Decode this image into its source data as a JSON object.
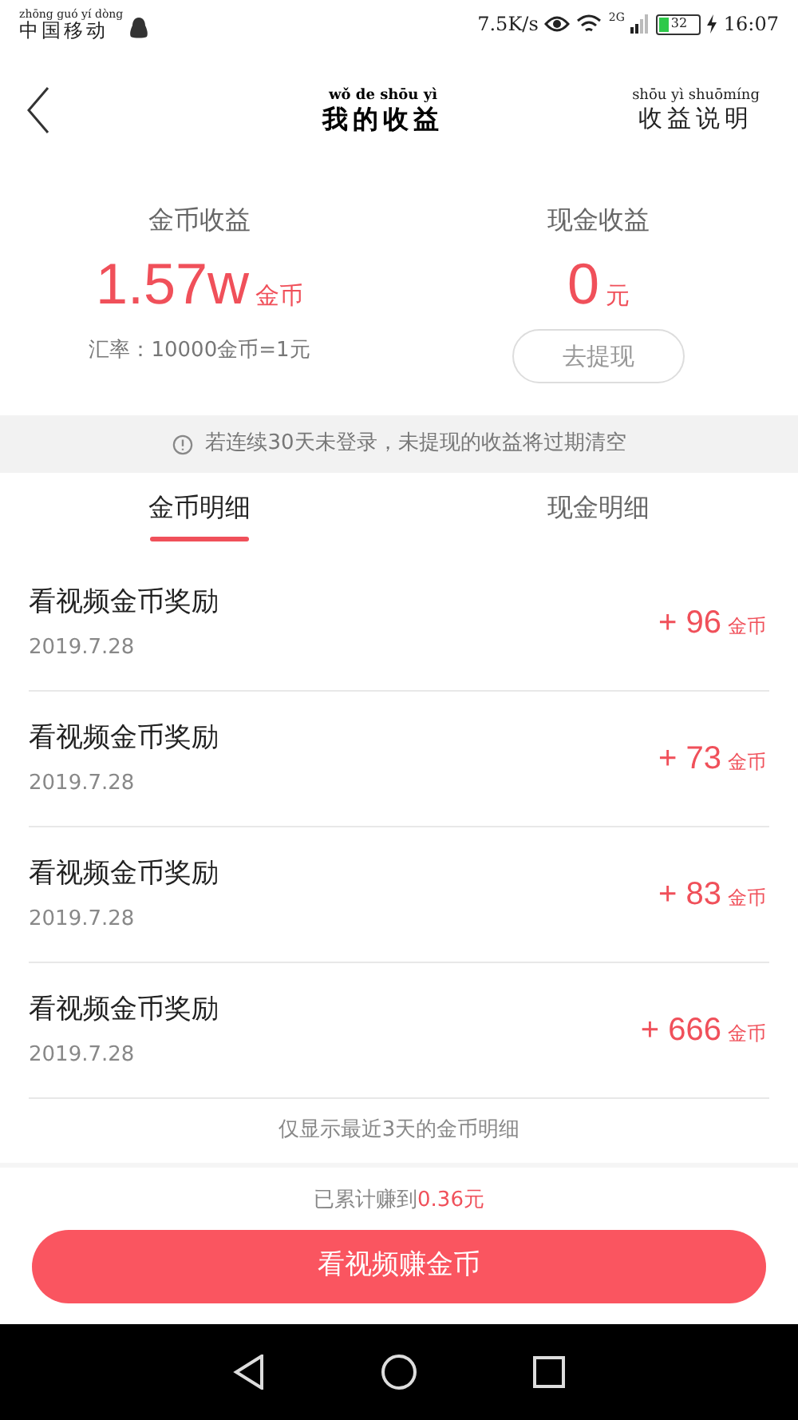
{
  "status_bar": {
    "carrier_pinyin": "zhōng guó yí dòng",
    "carrier": "中国移动",
    "speed": "7.5K/s",
    "network": "2G",
    "battery": "32",
    "time": "16:07"
  },
  "header": {
    "title_pinyin": "wǒ de shōu yì",
    "title": "我的收益",
    "action_pinyin": "shōu yì shuōmíng",
    "action": "收益说明"
  },
  "summary": [
    {
      "label": "金币收益",
      "value": "1.57w",
      "unit": "金币",
      "kind": "note",
      "note": "汇率：10000金币=1元"
    },
    {
      "label": "现金收益",
      "value": "0",
      "unit": "元",
      "kind": "button",
      "button": "去提现"
    }
  ],
  "notice": "若连续30天未登录，未提现的收益将过期清空",
  "tabs": [
    {
      "label": "金币明细",
      "selected": true
    },
    {
      "label": "现金明细",
      "selected": false
    }
  ],
  "records": [
    {
      "title": "看视频金币奖励",
      "date": "2019.7.28",
      "amount": "+ 96",
      "unit": "金币"
    },
    {
      "title": "看视频金币奖励",
      "date": "2019.7.28",
      "amount": "+ 73",
      "unit": "金币"
    },
    {
      "title": "看视频金币奖励",
      "date": "2019.7.28",
      "amount": "+ 83",
      "unit": "金币"
    },
    {
      "title": "看视频金币奖励",
      "date": "2019.7.28",
      "amount": "+ 666",
      "unit": "金币"
    }
  ],
  "records_note": "仅显示最近3天的金币明细",
  "footer": {
    "total_label": "已累计赚到",
    "total_value": "0.36元",
    "button": "看视频赚金币"
  }
}
